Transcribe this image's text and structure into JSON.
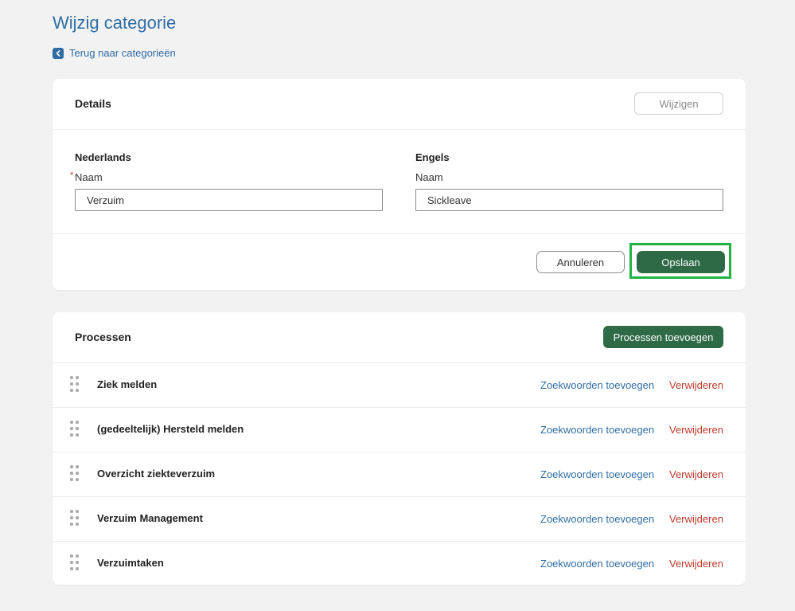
{
  "page": {
    "title": "Wijzig categorie",
    "back_link": "Terug naar categorieën"
  },
  "details": {
    "title": "Details",
    "edit_button": "Wijzigen",
    "dutch": {
      "heading": "Nederlands",
      "required_marker": "*",
      "name_label": "Naam",
      "name_value": "Verzuim"
    },
    "english": {
      "heading": "Engels",
      "name_label": "Naam",
      "name_value": "Sickleave"
    },
    "cancel_button": "Annuleren",
    "save_button": "Opslaan"
  },
  "processes": {
    "title": "Processen",
    "add_button": "Processen toevoegen",
    "items": [
      {
        "name": "Ziek melden",
        "add_keywords": "Zoekwoorden toevoegen",
        "delete": "Verwijderen"
      },
      {
        "name": "(gedeeltelijk) Hersteld melden",
        "add_keywords": "Zoekwoorden toevoegen",
        "delete": "Verwijderen"
      },
      {
        "name": "Overzicht ziekteverzuim",
        "add_keywords": "Zoekwoorden toevoegen",
        "delete": "Verwijderen"
      },
      {
        "name": "Verzuim Management",
        "add_keywords": "Zoekwoorden toevoegen",
        "delete": "Verwijderen"
      },
      {
        "name": "Verzuimtaken",
        "add_keywords": "Zoekwoorden toevoegen",
        "delete": "Verwijderen"
      }
    ]
  },
  "icons": {
    "back": "chevron-left-icon",
    "drag": "drag-handle-icon"
  },
  "colors": {
    "link": "#2f6ea5",
    "primary_button": "#2d6a45",
    "danger": "#c0392b",
    "highlight": "#21b443",
    "background": "#f2f2f2"
  }
}
